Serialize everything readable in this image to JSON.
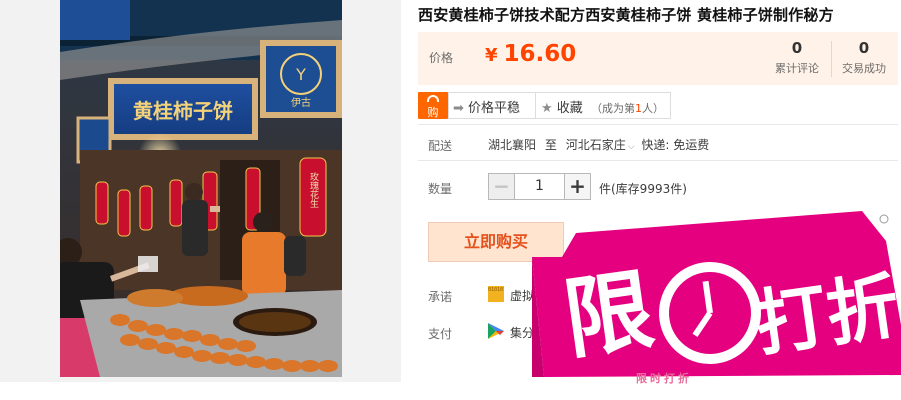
{
  "product": {
    "title": "西安黄桂柿子饼技术配方西安黄桂柿子饼 黄桂柿子饼制作秘方",
    "photo_sign": "黄桂柿子饼",
    "photo_shop_mark": "伊古",
    "photo_lantern_text": "玫瑰花生"
  },
  "price": {
    "label": "价格",
    "currency": "¥",
    "value": "16.60",
    "stats": [
      {
        "num": "0",
        "label": "累计评论"
      },
      {
        "num": "0",
        "label": "交易成功"
      }
    ]
  },
  "tools": {
    "buy_badge": "购",
    "compare_label": "价格平稳",
    "favorite_label": "收藏",
    "favorite_note_prefix": "（成为第",
    "favorite_note_rank": "1",
    "favorite_note_suffix": "人）"
  },
  "shipping": {
    "label": "配送",
    "from": "湖北襄阳",
    "to_word": "至",
    "to": "河北石家庄",
    "method": "快递: 免运费"
  },
  "quantity": {
    "label": "数量",
    "value": "1",
    "minus": "−",
    "plus": "+",
    "unit_stock": "件(库存9993件)"
  },
  "buy_now": "立即购买",
  "promise": {
    "label": "承诺",
    "icon_text": "010101",
    "text": "虚拟"
  },
  "payment": {
    "label": "支付",
    "text": "集分"
  },
  "promo": {
    "text_1": "限",
    "text_2": "打折",
    "under_text": "限时打折"
  },
  "colors": {
    "price": "#ff4400",
    "price_bg": "#fff2e8",
    "buy_now_bg": "#ffe4d0",
    "promo_pink": "#e4007f"
  }
}
